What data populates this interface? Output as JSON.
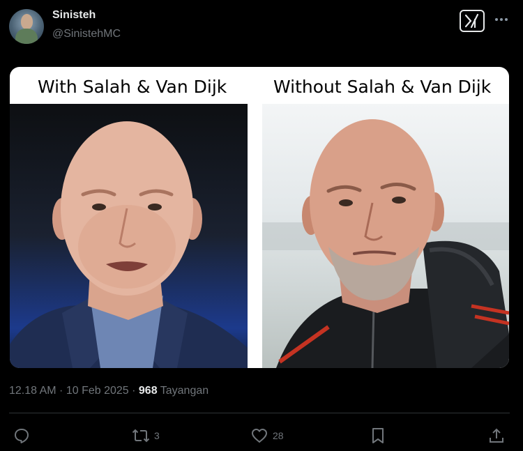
{
  "tweet": {
    "author": {
      "display_name": "Sinisteh",
      "handle": "@SinistehMC",
      "avatar_icon": "profile-avatar"
    },
    "header_icons": [
      "grok-icon",
      "more-icon"
    ],
    "media": {
      "left_caption": "With Salah & Van Dijk",
      "right_caption": "Without Salah & Van Dijk"
    },
    "meta": {
      "timestamp": "12.18 AM · 10 Feb 2025",
      "separator": " · ",
      "views_count": "968",
      "views_label": "Tayangan"
    },
    "actions": {
      "reply_count": "",
      "retweet_count": "3",
      "like_count": "28",
      "icons": [
        "reply-icon",
        "retweet-icon",
        "like-icon",
        "bookmark-icon",
        "share-icon"
      ]
    }
  }
}
